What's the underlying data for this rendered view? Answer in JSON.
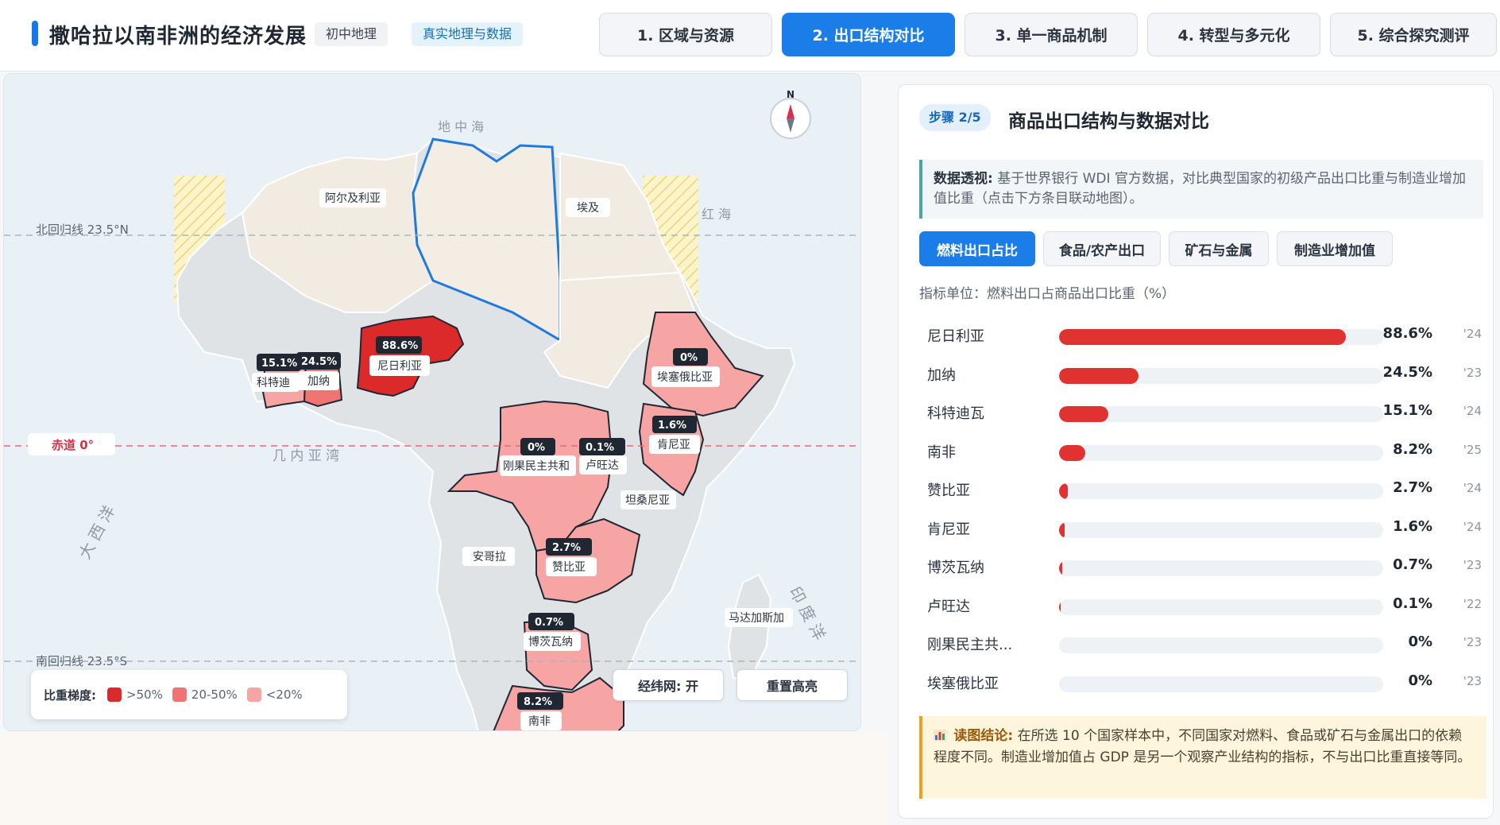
{
  "header": {
    "title": "撒哈拉以南非洲的经济发展",
    "tags": [
      "初中地理",
      "真实地理与数据"
    ],
    "tabs": [
      {
        "label": "1. 区域与资源",
        "active": false
      },
      {
        "label": "2. 出口结构对比",
        "active": true
      },
      {
        "label": "3. 单一商品机制",
        "active": false
      },
      {
        "label": "4. 转型与多元化",
        "active": false
      },
      {
        "label": "5. 综合探究测评",
        "active": false
      }
    ]
  },
  "map": {
    "sea_labels": {
      "mediterranean": "地 中 海",
      "red_sea": "红 海",
      "gulf_guinea": "几 内 亚 湾",
      "atlantic": "大 西 洋",
      "indian": "印 度 洋"
    },
    "lines": {
      "tropic_cancer": "北回归线 23.5°N",
      "equator": "赤道 0°",
      "tropic_capricorn": "南回归线 23.5°S"
    },
    "compass": "N",
    "country_labels": {
      "algeria": "阿尔及利亚",
      "egypt": "埃及",
      "angola": "安哥拉",
      "tanzania": "坦桑尼亚",
      "madagascar": "马达加斯加"
    },
    "highlights": [
      {
        "name": "尼日利亚",
        "value": "88.6%",
        "level": "high"
      },
      {
        "name": "加纳",
        "value": "24.5%",
        "level": "mid"
      },
      {
        "name": "科特迪",
        "value": "15.1%",
        "level": "low"
      },
      {
        "name": "埃塞俄比亚",
        "value": "0%",
        "level": "low"
      },
      {
        "name": "肯尼亚",
        "value": "1.6%",
        "level": "low"
      },
      {
        "name": "刚果民主共和",
        "value": "0%",
        "level": "low"
      },
      {
        "name": "卢旺达",
        "value": "0.1%",
        "level": "low"
      },
      {
        "name": "赞比亚",
        "value": "2.7%",
        "level": "low"
      },
      {
        "name": "博茨瓦纳",
        "value": "0.7%",
        "level": "low"
      },
      {
        "name": "南非",
        "value": "8.2%",
        "level": "low"
      }
    ],
    "legend": {
      "title": "比重梯度:",
      "items": [
        {
          "label": ">50%",
          "color": "#dc2a2a"
        },
        {
          "label": "20-50%",
          "color": "#f17474"
        },
        {
          "label": "<20%",
          "color": "#f7a4a4"
        }
      ]
    },
    "buttons": {
      "grid": "经纬网: 开",
      "reset": "重置高亮"
    }
  },
  "panel": {
    "step": "步骤 2/5",
    "title": "商品出口结构与数据对比",
    "insight_label": "数据透视:",
    "insight_text": "基于世界银行 WDI 官方数据，对比典型国家的初级产品出口比重与制造业增加值比重（点击下方条目联动地图）。",
    "subtabs": [
      {
        "label": "燃料出口占比",
        "active": true
      },
      {
        "label": "食品/农产出口",
        "active": false
      },
      {
        "label": "矿石与金属",
        "active": false
      },
      {
        "label": "制造业增加值",
        "active": false
      }
    ],
    "unit": "指标单位：燃料出口占商品出口比重（%）",
    "rows": [
      {
        "name": "尼日利亚",
        "value": "88.6%",
        "pct": 88.6,
        "year": "'24"
      },
      {
        "name": "加纳",
        "value": "24.5%",
        "pct": 24.5,
        "year": "'23"
      },
      {
        "name": "科特迪瓦",
        "value": "15.1%",
        "pct": 15.1,
        "year": "'24"
      },
      {
        "name": "南非",
        "value": "8.2%",
        "pct": 8.2,
        "year": "'25"
      },
      {
        "name": "赞比亚",
        "value": "2.7%",
        "pct": 2.7,
        "year": "'24"
      },
      {
        "name": "肯尼亚",
        "value": "1.6%",
        "pct": 1.6,
        "year": "'24"
      },
      {
        "name": "博茨瓦纳",
        "value": "0.7%",
        "pct": 0.7,
        "year": "'23"
      },
      {
        "name": "卢旺达",
        "value": "0.1%",
        "pct": 0.1,
        "year": "'22"
      },
      {
        "name": "刚果民主共...",
        "value": "0%",
        "pct": 0,
        "year": "'23"
      },
      {
        "name": "埃塞俄比亚",
        "value": "0%",
        "pct": 0,
        "year": "'23"
      }
    ],
    "conclusion_icon": "bar-chart-icon",
    "conclusion_label": "读图结论:",
    "conclusion_text": "在所选 10 个国家样本中，不同国家对燃料、食品或矿石与金属出口的依赖程度不同。制造业增加值占 GDP 是另一个观察产业结构的指标，不与出口比重直接等同。"
  }
}
